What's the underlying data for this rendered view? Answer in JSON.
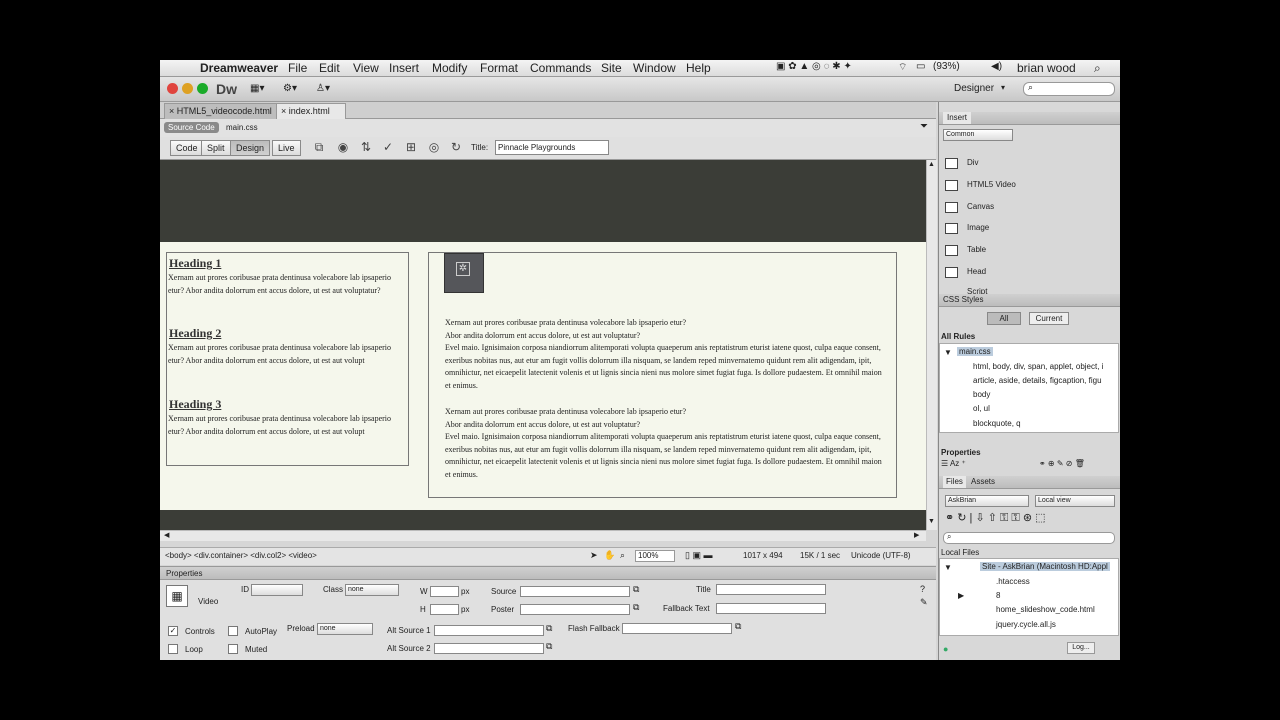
{
  "menubar": {
    "app": "Dreamweaver",
    "items": [
      "File",
      "Edit",
      "View",
      "Insert",
      "Modify",
      "Format",
      "Commands",
      "Site",
      "Window",
      "Help"
    ],
    "battery": "(93%)",
    "user": "brian wood"
  },
  "appbar": {
    "logo": "Dw",
    "workspace": "Designer"
  },
  "doc_tabs": [
    "HTML5_videocode.html",
    "index.html"
  ],
  "related": {
    "source": "Source Code",
    "css": "main.css"
  },
  "docbar": {
    "views": [
      "Code",
      "Split",
      "Design",
      "Live"
    ],
    "title_label": "Title:",
    "title_value": "Pinnacle Playgrounds"
  },
  "page": {
    "col1": [
      {
        "heading": "Heading 1",
        "text": "Xernam aut prores coribusae prata dentinusa volecabore lab ipsaperio etur? Abor andita dolorrum ent accus dolore, ut est aut voluptatur?"
      },
      {
        "heading": "Heading 2",
        "text": "Xernam aut prores coribusae prata dentinusa volecabore lab ipsaperio etur? Abor andita dolorrum ent accus dolore, ut est aut volupt"
      },
      {
        "heading": "Heading 3",
        "text": "Xernam aut prores coribusae prata dentinusa volecabore lab ipsaperio etur? Abor andita dolorrum ent accus dolore, ut est aut volupt"
      }
    ],
    "col2": [
      {
        "l1": "Xernam aut prores coribusae prata dentinusa volecabore lab ipsaperio etur?",
        "l2": "Abor andita dolorrum ent accus dolore, ut est aut voluptatur?",
        "l3": "Evel maio. Ignisimaion corposa niandiorrum alitemporati volupta quaeperum anis reptatistrum eturist iatene quost, culpa eaque consent, exeribus nobitas nus, aut etur am fugit vollis dolorrum illa nisquam, se landem reped minvernatemo quidunt rem alit adigendam, ipit, omnihictur, net eicaepelit latectenit volenis et ut lignis sincia nieni nus molore simet fugiat fuga. Is dollore pudaestem. Et omnihil maion et enimus."
      },
      {
        "l1": "Xernam aut prores coribusae prata dentinusa volecabore lab ipsaperio etur?",
        "l2": "Abor andita dolorrum ent accus dolore, ut est aut voluptatur?",
        "l3": "Evel maio. Ignisimaion corposa niandiorrum alitemporati volupta quaeperum anis reptatistrum eturist iatene quost, culpa eaque consent, exeribus nobitas nus, aut etur am fugit vollis dolorrum illa nisquam, se landem reped minvernatemo quidunt rem alit adigendam, ipit, omnihictur, net eicaepelit latectenit volenis et ut lignis sincia nieni nus molore simet fugiat fuga. Is dollore pudaestem. Et omnihil maion et enimus."
      }
    ]
  },
  "status": {
    "tags": "<body> <div.container> <div.col2> <video>",
    "zoom": "100%",
    "size": "1017 x 494",
    "download": "15K / 1 sec",
    "encoding": "Unicode (UTF-8)"
  },
  "props": {
    "title": "Properties",
    "type": "Video",
    "id_label": "ID",
    "class_label": "Class",
    "class_value": "none",
    "w_label": "W",
    "h_label": "H",
    "px": "px",
    "source": "Source",
    "poster": "Poster",
    "title_label": "Title",
    "fallback": "Fallback Text",
    "controls": "Controls",
    "autoplay": "AutoPlay",
    "preload": "Preload",
    "preload_value": "none",
    "loop": "Loop",
    "muted": "Muted",
    "alt1": "Alt Source 1",
    "alt2": "Alt Source 2",
    "flash": "Flash Fallback"
  },
  "insert": {
    "title": "Insert",
    "category": "Common",
    "items": [
      "Div",
      "HTML5 Video",
      "Canvas",
      "Image",
      "Table",
      "Head",
      "Script"
    ]
  },
  "css": {
    "title": "CSS Styles",
    "all": "All",
    "current": "Current",
    "all_rules": "All Rules",
    "file": "main.css",
    "rules": [
      "html, body, div, span, applet, object, i",
      "article, aside, details, figcaption, figu",
      "body",
      "ol, ul",
      "blockquote, q"
    ]
  },
  "props_panel": {
    "title": "Properties"
  },
  "files": {
    "tab1": "Files",
    "tab2": "Assets",
    "site": "AskBrian",
    "view": "Local view",
    "local": "Local Files",
    "root": "Site - AskBrian (Macintosh HD:Appl",
    "items": [
      ".htaccess",
      "8",
      "home_slideshow_code.html",
      "jquery.cycle.all.js"
    ],
    "log": "Log..."
  }
}
